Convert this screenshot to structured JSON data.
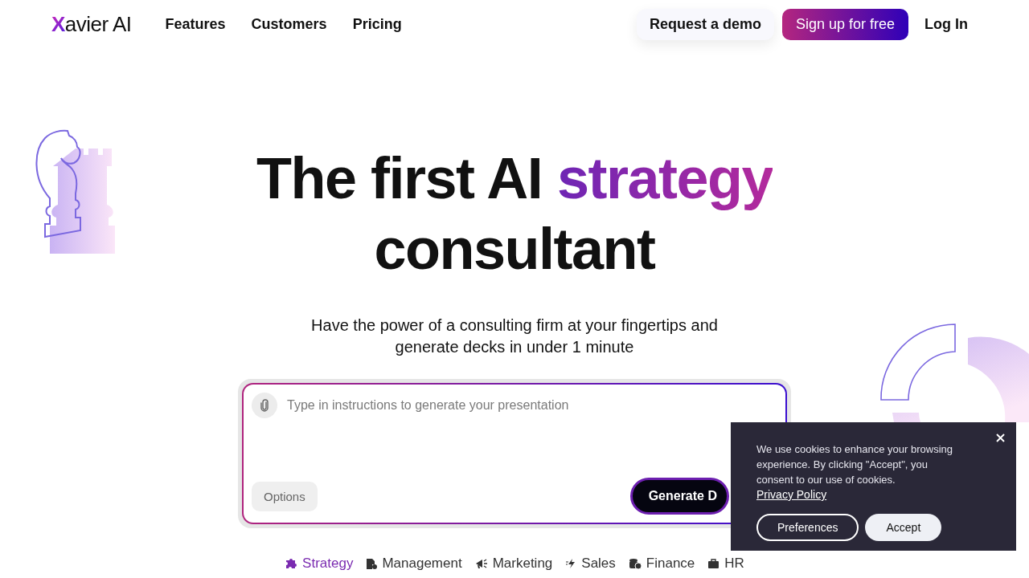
{
  "nav": {
    "logo_mark": "X",
    "logo_text": "avier AI",
    "links": [
      "Features",
      "Customers",
      "Pricing"
    ],
    "demo_button": "Request a demo",
    "signup_button": "Sign up for free",
    "login": "Log In"
  },
  "hero": {
    "title_start": "The first AI ",
    "title_highlight": "strategy",
    "title_end": "consultant",
    "subtitle": "Have the power of a consulting firm at your fingertips and generate decks in under 1 minute"
  },
  "prompt": {
    "placeholder": "Type in instructions to generate your presentation",
    "options_button": "Options",
    "generate_button": "Generate D"
  },
  "categories": [
    {
      "label": "Strategy",
      "kind": "puzzle",
      "selected": true
    },
    {
      "label": "Management",
      "kind": "document",
      "selected": false
    },
    {
      "label": "Marketing",
      "kind": "megaphone",
      "selected": false
    },
    {
      "label": "Sales",
      "kind": "bolt",
      "selected": false
    },
    {
      "label": "Finance",
      "kind": "coins",
      "selected": false
    },
    {
      "label": "HR",
      "kind": "briefcase",
      "selected": false
    }
  ],
  "cookie_banner": {
    "text": "We use cookies to enhance your browsing experience. By clicking \"Accept\", you consent to our use of cookies.",
    "link": "Privacy Policy",
    "preferences_button": "Preferences",
    "accept_button": "Accept"
  }
}
